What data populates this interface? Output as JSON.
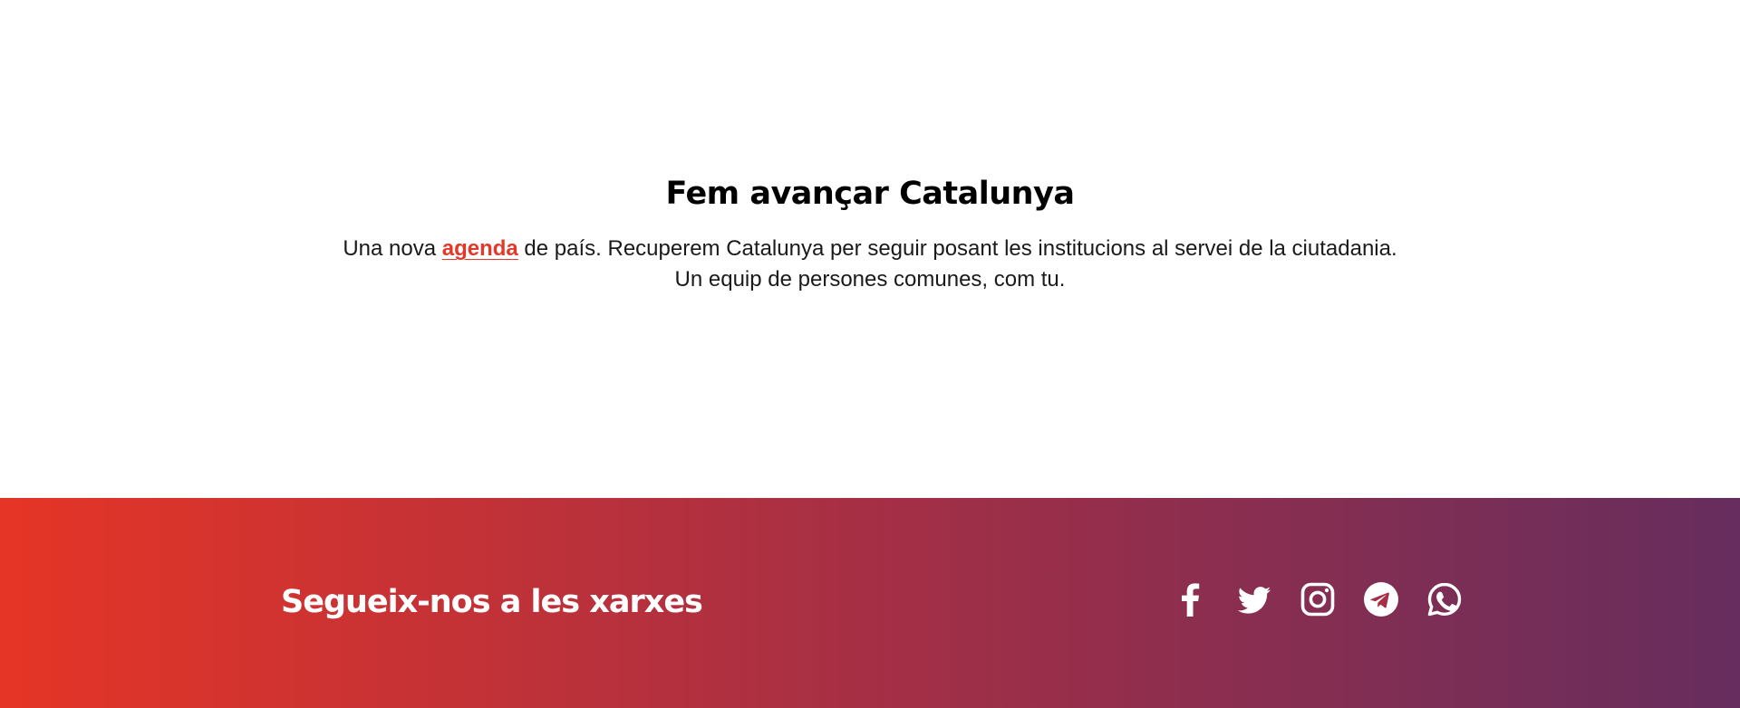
{
  "intro": {
    "title": "Fem avançar Catalunya",
    "text_before_link": "Una nova ",
    "link_text": "agenda",
    "text_after_link": " de país. Recuperem Catalunya per seguir posant les institucions al servei de la ciutadania.",
    "line2": "Un equip de persones comunes, com tu."
  },
  "footer": {
    "title": "Segueix-nos a les xarxes",
    "social_icons": [
      "facebook-icon",
      "twitter-icon",
      "instagram-icon",
      "telegram-icon",
      "whatsapp-icon"
    ]
  },
  "colors": {
    "accent": "#e4392a",
    "gradient_start": "#e53526",
    "gradient_end": "#662d5e"
  }
}
